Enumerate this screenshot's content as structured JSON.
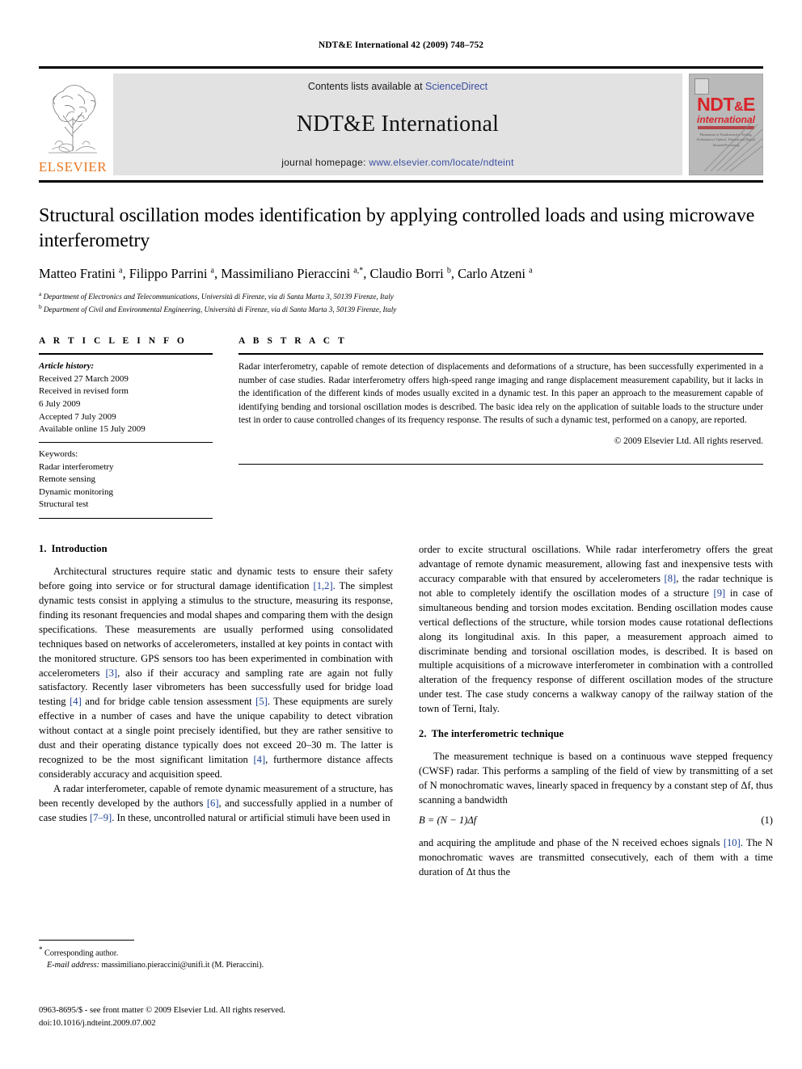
{
  "running_head": "NDT&E International 42 (2009) 748–752",
  "masthead": {
    "publisher_logo_name": "ELSEVIER",
    "contents_prefix": "Contents lists available at ",
    "contents_link": "ScienceDirect",
    "journal_title": "NDT&E International",
    "homepage_prefix": "journal homepage: ",
    "homepage_url": "www.elsevier.com/locate/ndteint",
    "cover": {
      "title_main": "NDT",
      "title_amp": "&",
      "title_tail": "E",
      "subtitle": "international",
      "blurb": "Phenomena of Nondestructive Testing, Evaluation of Optical, Thermal and Digital Infrared Processing"
    },
    "link_color": "#3b4ea0",
    "cover_accent": "#d8242a",
    "elsevier_orange": "#E87722"
  },
  "article": {
    "title": "Structural oscillation modes identification by applying controlled loads and using microwave interferometry",
    "authors_html": "Matteo Fratini <sup>a</sup>, Filippo Parrini <sup>a</sup>, Massimiliano Pieraccini <sup>a,*</sup>, Claudio Borri <sup>b</sup>, Carlo Atzeni <sup>a</sup>",
    "affiliations": [
      "Department of Electronics and Telecommunications, Università di Firenze, via di Santa Marta 3, 50139 Firenze, Italy",
      "Department of Civil and Environmental Engineering, Università di Firenze, via di Santa Marta 3, 50139 Firenze, Italy"
    ],
    "affiliation_markers": [
      "a",
      "b"
    ]
  },
  "article_info": {
    "heading": "A R T I C L E   I N F O",
    "history_label": "Article history:",
    "history": [
      "Received 27 March 2009",
      "Received in revised form",
      "6 July 2009",
      "Accepted 7 July 2009",
      "Available online 15 July 2009"
    ],
    "keywords_label": "Keywords:",
    "keywords": [
      "Radar interferometry",
      "Remote sensing",
      "Dynamic monitoring",
      "Structural test"
    ]
  },
  "abstract": {
    "heading": "A B S T R A C T",
    "text": "Radar interferometry, capable of remote detection of displacements and deformations of a structure, has been successfully experimented in a number of case studies. Radar interferometry offers high-speed range imaging and range displacement measurement capability, but it lacks in the identification of the different kinds of modes usually excited in a dynamic test. In this paper an approach to the measurement capable of identifying bending and torsional oscillation modes is described. The basic idea rely on the application of suitable loads to the structure under test in order to cause controlled changes of its frequency response. The results of such a dynamic test, performed on a canopy, are reported.",
    "copyright": "© 2009 Elsevier Ltd. All rights reserved."
  },
  "sections": {
    "intro": {
      "number": "1.",
      "title": "Introduction",
      "p1_a": "Architectural structures require static and dynamic tests to ensure their safety before going into service or for structural damage identification ",
      "p1_cite1": "[1,2]",
      "p1_b": ". The simplest dynamic tests consist in applying a stimulus to the structure, measuring its response, finding its resonant frequencies and modal shapes and comparing them with the design specifications. These measurements are usually performed using consolidated techniques based on networks of accelerometers, installed at key points in contact with the monitored structure. GPS sensors too has been experimented in combination with accelerometers ",
      "p1_cite2": "[3]",
      "p1_c": ", also if their accuracy and sampling rate are again not fully satisfactory. Recently laser vibrometers has been successfully used for bridge load testing ",
      "p1_cite3": "[4]",
      "p1_d": " and for bridge cable tension assessment ",
      "p1_cite4": "[5]",
      "p1_e": ". These equipments are surely effective in a number of cases and have the unique capability to detect vibration without contact at a single point precisely identified, but they are rather sensitive to dust and their operating distance typically does not exceed 20–30 m. The latter is recognized to be the most significant limitation ",
      "p1_cite5": "[4]",
      "p1_f": ", furthermore distance affects considerably accuracy and acquisition speed.",
      "p2_a": "A radar interferometer, capable of remote dynamic measurement of a structure, has been recently developed by the authors ",
      "p2_cite1": "[6]",
      "p2_b": ", and successfully applied in a number of case studies ",
      "p2_cite2": "[7–9]",
      "p2_c": ". In these, uncontrolled natural or artificial stimuli have been used in order to excite structural oscillations. While radar interferometry offers the great advantage of remote dynamic measurement, allowing fast and inexpensive tests with accuracy comparable with that ensured by accelerometers ",
      "p2_cite3": "[8]",
      "p2_d": ", the radar technique is not able to completely identify the oscillation modes of a structure ",
      "p2_cite4": "[9]",
      "p2_e": " in case of simultaneous bending and torsion modes excitation. Bending oscillation modes cause vertical deflections of the structure, while torsion modes cause rotational deflections along its longitudinal axis. In this paper, a measurement approach aimed to discriminate bending and torsional oscillation modes, is described. It is based on multiple acquisitions of a microwave interferometer in combination with a controlled alteration of the frequency response of different oscillation modes of the structure under test. The case study concerns a walkway canopy of the railway station of the town of Terni, Italy."
    },
    "technique": {
      "number": "2.",
      "title": "The interferometric technique",
      "p1": "The measurement technique is based on a continuous wave stepped frequency (CWSF) radar. This performs a sampling of the field of view by transmitting of a set of N monochromatic waves, linearly spaced in frequency by a constant step of Δf, thus scanning a bandwidth",
      "equation": "B = (N − 1)Δf",
      "equation_number": "(1)",
      "p2_a": "and acquiring the amplitude and phase of the N received echoes signals ",
      "p2_cite1": "[10]",
      "p2_b": ". The N monochromatic waves are transmitted consecutively, each of them with a time duration of Δt thus the"
    }
  },
  "footnote": {
    "corresponding": "Corresponding author.",
    "email_label": "E-mail address:",
    "email": "massimiliano.pieraccini@unifi.it (M. Pieraccini)."
  },
  "imprint": {
    "line1": "0963-8695/$ - see front matter © 2009 Elsevier Ltd. All rights reserved.",
    "line2": "doi:10.1016/j.ndteint.2009.07.002"
  }
}
